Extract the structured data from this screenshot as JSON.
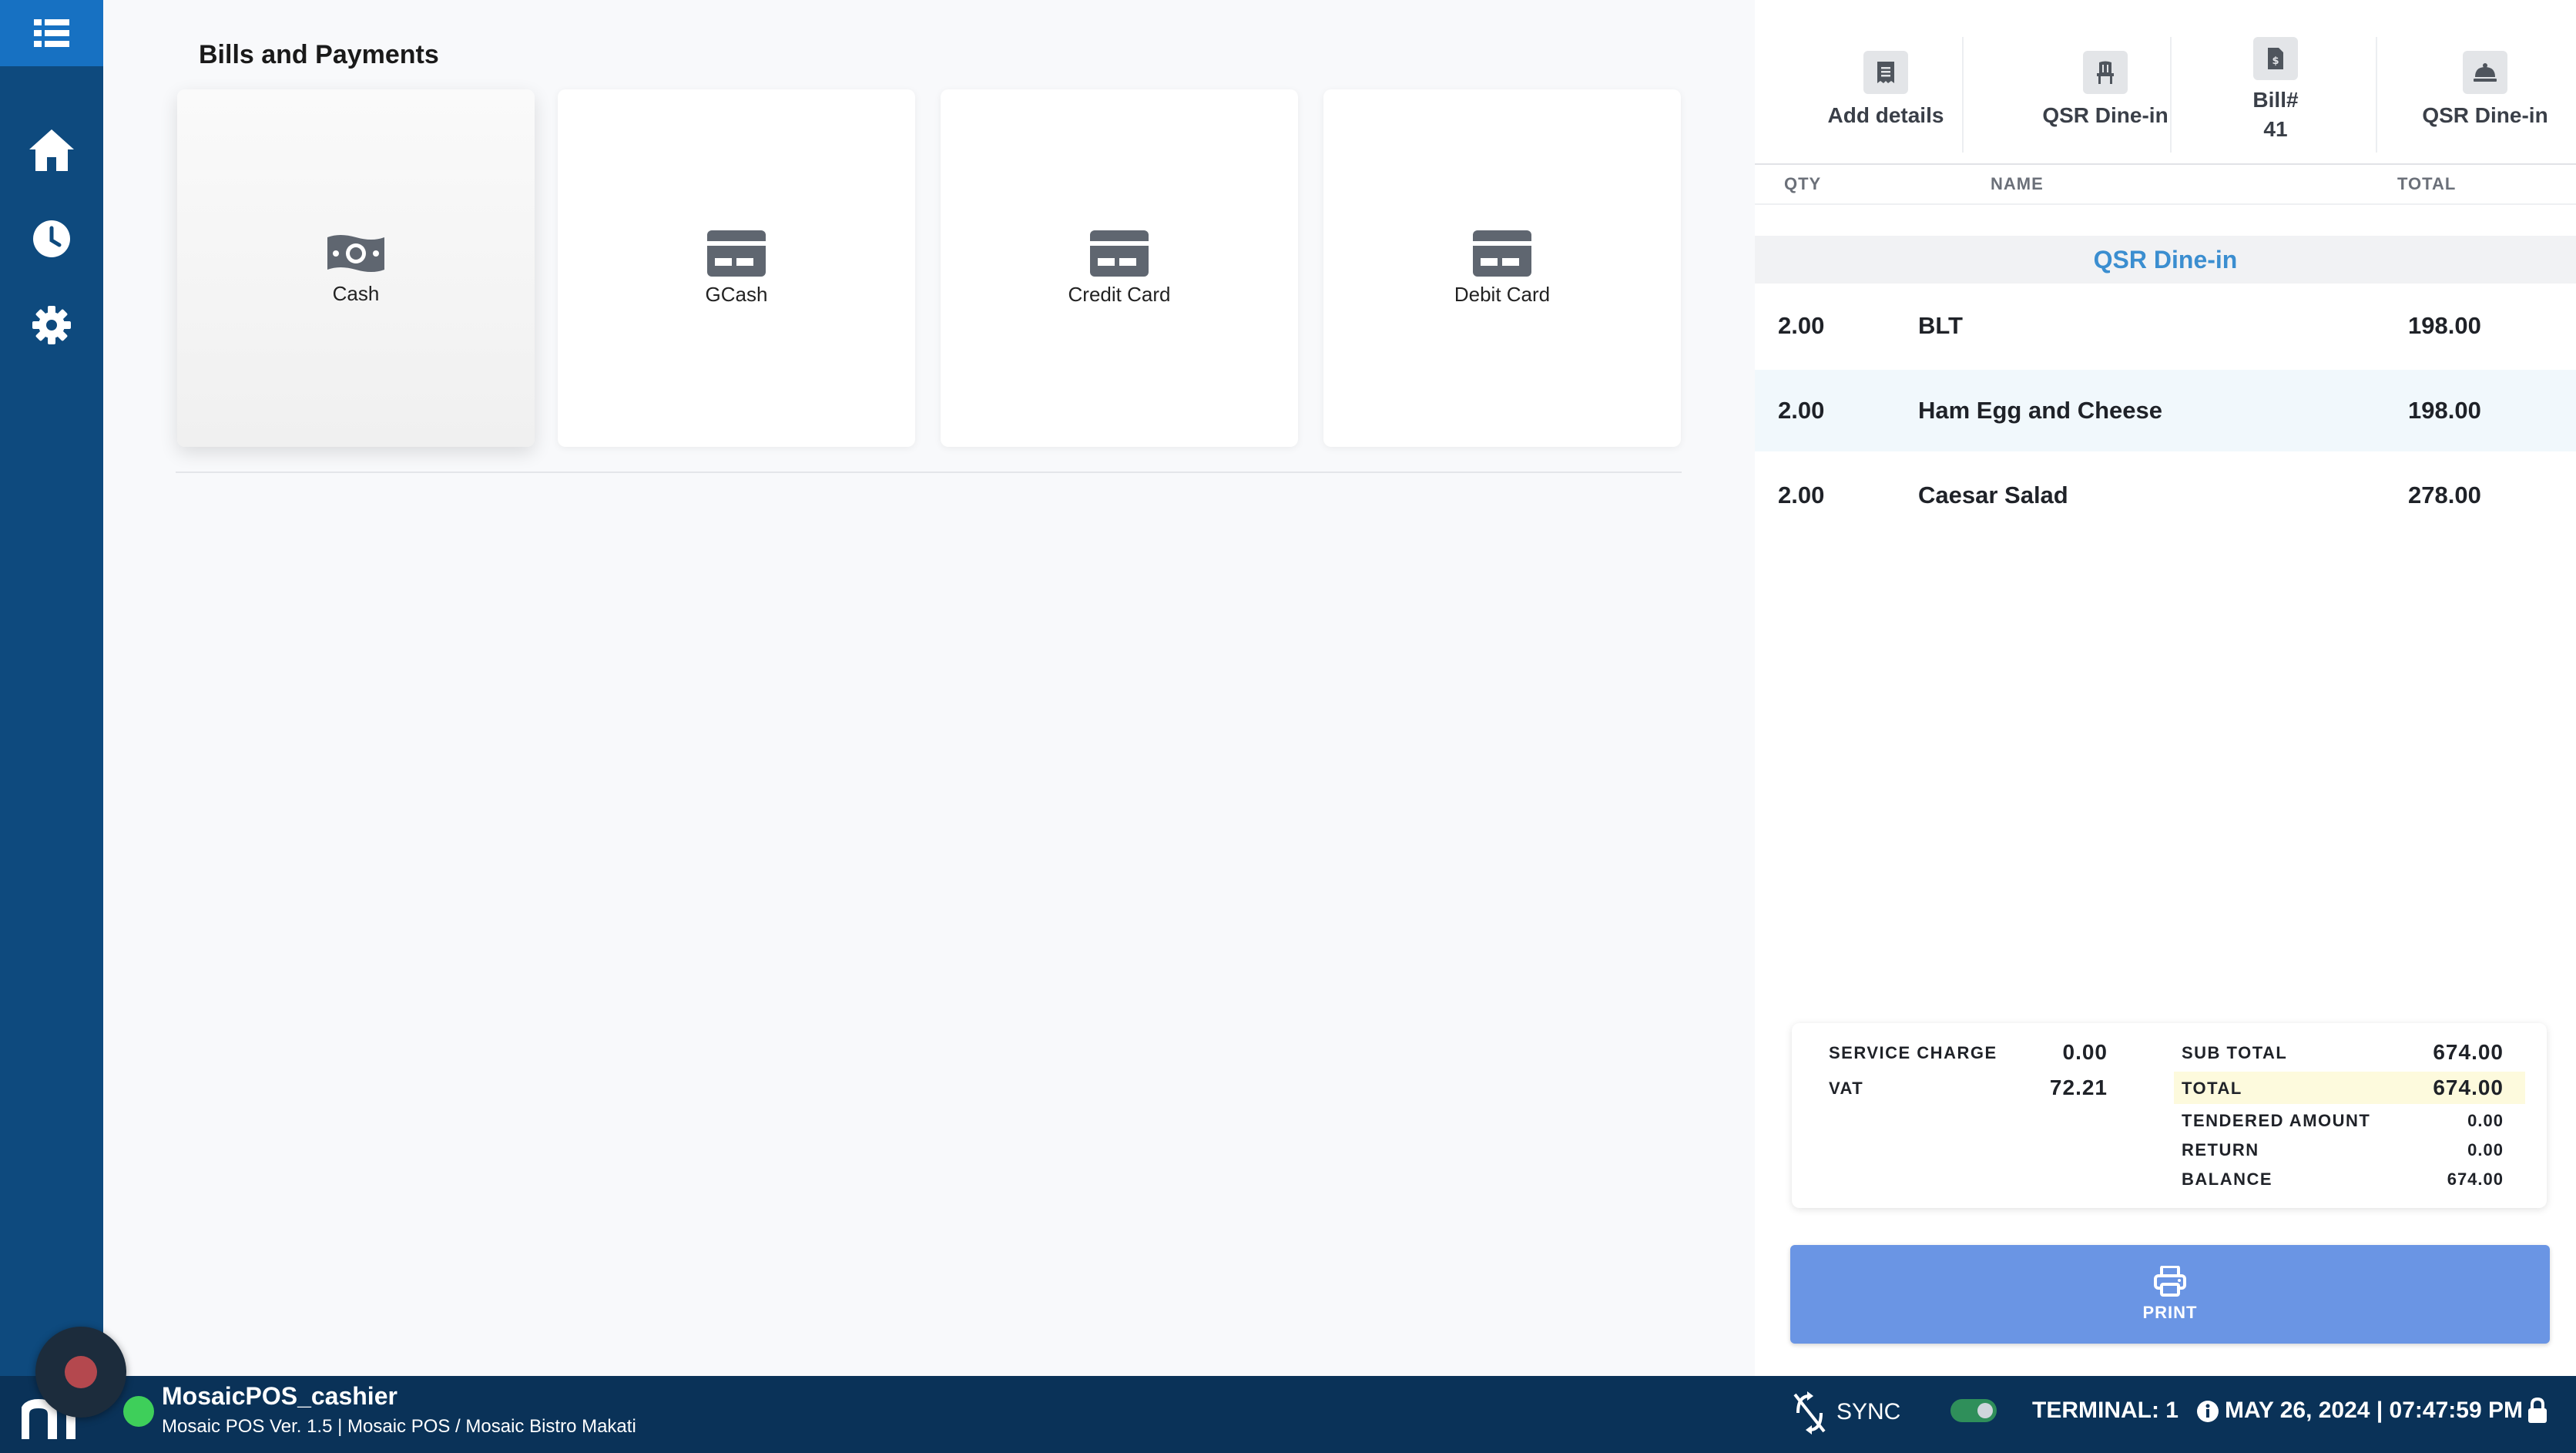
{
  "header": {
    "title": "Bills and Payments"
  },
  "payment_methods": [
    {
      "label": "Cash",
      "icon": "money-icon",
      "selected": true
    },
    {
      "label": "GCash",
      "icon": "card-icon",
      "selected": false
    },
    {
      "label": "Credit Card",
      "icon": "card-icon",
      "selected": false
    },
    {
      "label": "Debit Card",
      "icon": "card-icon",
      "selected": false
    }
  ],
  "order_actions": [
    {
      "label": "Add details",
      "icon": "receipt-icon"
    },
    {
      "label": "QSR Dine-in",
      "icon": "chair-icon"
    },
    {
      "label": "Bill#",
      "value": "41",
      "icon": "bill-icon"
    },
    {
      "label": "QSR Dine-in",
      "icon": "cloche-icon"
    }
  ],
  "order_table": {
    "headers": {
      "qty": "QTY",
      "name": "NAME",
      "total": "TOTAL"
    },
    "section": "QSR Dine-in",
    "items": [
      {
        "qty": "2.00",
        "name": "BLT",
        "total": "198.00"
      },
      {
        "qty": "2.00",
        "name": "Ham Egg and Cheese",
        "total": "198.00"
      },
      {
        "qty": "2.00",
        "name": "Caesar Salad",
        "total": "278.00"
      }
    ]
  },
  "summary": {
    "service_charge_label": "SERVICE CHARGE",
    "service_charge": "0.00",
    "vat_label": "VAT",
    "vat": "72.21",
    "subtotal_label": "SUB TOTAL",
    "subtotal": "674.00",
    "total_label": "TOTAL",
    "total": "674.00",
    "tendered_label": "TENDERED AMOUNT",
    "tendered": "0.00",
    "return_label": "RETURN",
    "return": "0.00",
    "balance_label": "BALANCE",
    "balance": "674.00"
  },
  "print_button": {
    "label": "PRINT"
  },
  "footer": {
    "username": "MosaicPOS_cashier",
    "version_info": "Mosaic POS Ver. 1.5 | Mosaic POS / Mosaic Bistro Makati",
    "sync_label": "SYNC",
    "terminal": "TERMINAL: 1",
    "datetime": "MAY 26, 2024 | 07:47:59 PM"
  },
  "colors": {
    "sidebar": "#0e4a7e",
    "sidebar_top": "#1771c2",
    "footer": "#0a3258",
    "accent": "#3b8ed0",
    "print_button": "#6a95e4",
    "online_status": "#3ecf5a"
  }
}
